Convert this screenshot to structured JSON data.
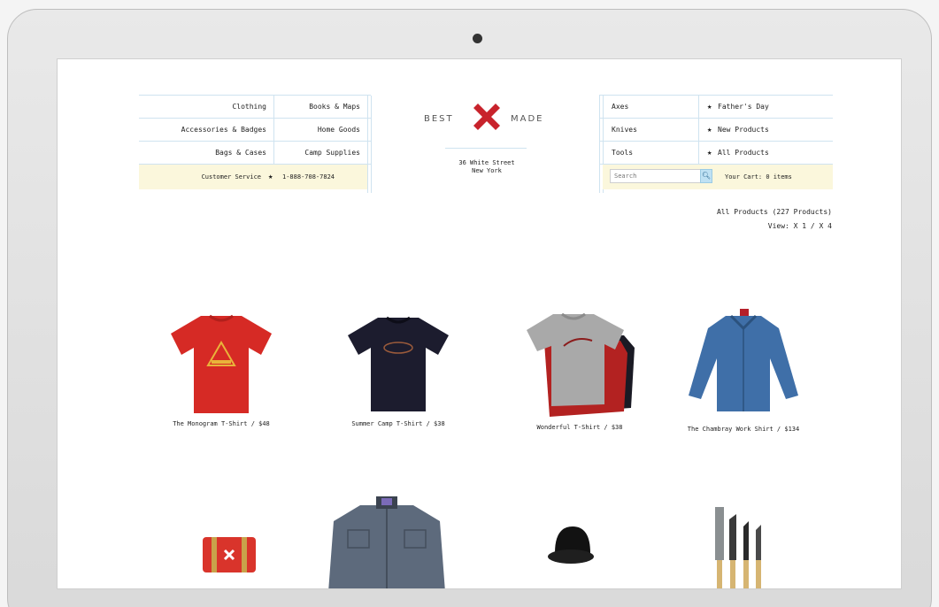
{
  "nav_left": {
    "rows": [
      {
        "left": "Clothing",
        "right": "Books & Maps"
      },
      {
        "left": "Accessories & Badges",
        "right": "Home Goods"
      },
      {
        "left": "Bags & Cases",
        "right": "Camp Supplies"
      }
    ],
    "customer_service": "Customer Service",
    "phone": "1-888-708-7824"
  },
  "logo": {
    "left_word": "BEST",
    "right_word": "MADE"
  },
  "address": {
    "line1": "36 White Street",
    "line2": "New York"
  },
  "nav_right": {
    "rows": [
      {
        "left": "Axes",
        "right": "Father's Day"
      },
      {
        "left": "Knives",
        "right": "New Products"
      },
      {
        "left": "Tools",
        "right": "All Products"
      }
    ],
    "search_placeholder": "Search",
    "cart": "Your Cart: 0 items"
  },
  "listing": {
    "title": "All Products (227 Products)",
    "view": "View: X 1 / X 4"
  },
  "products": [
    {
      "caption": "The Monogram T-Shirt / $48",
      "color": "#d62a25"
    },
    {
      "caption": "Summer Camp T-Shirt / $38",
      "color": "#1c1c2e"
    },
    {
      "caption": "Wonderful T-Shirt / $38",
      "color": "#a9a9a9"
    },
    {
      "caption": "The Chambray Work Shirt / $134",
      "color": "#3f6fa8"
    }
  ],
  "colors": {
    "accent_red": "#c8232c",
    "grid_line": "#cfe3f0",
    "highlight_yellow": "#fbf7dc"
  }
}
